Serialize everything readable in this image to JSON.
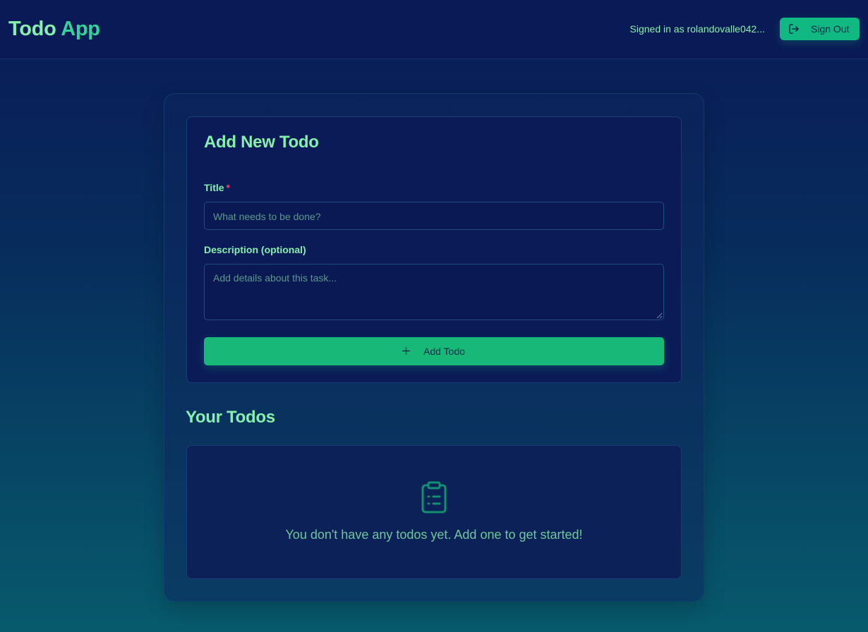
{
  "header": {
    "logo_word1": "Todo",
    "logo_word2": "App",
    "signed_in_text": "Signed in as rolandovalle042...",
    "sign_out_label": "Sign Out",
    "sign_out_icon": "log-out-icon"
  },
  "form": {
    "title": "Add New Todo",
    "title_label": "Title",
    "required_marker": "*",
    "title_placeholder": "What needs to be done?",
    "title_value": "",
    "description_label": "Description (optional)",
    "description_placeholder": "Add details about this task...",
    "description_value": "",
    "add_button_label": "Add Todo",
    "add_button_icon": "plus-icon"
  },
  "todos": {
    "heading": "Your Todos",
    "items": [],
    "empty_icon": "clipboard-list-icon",
    "empty_message": "You don't have any todos yet. Add one to get started!"
  },
  "colors": {
    "accent": "#10b981",
    "text_primary": "#86efac",
    "text_logo_secondary": "#34d399",
    "required": "#f43f5e",
    "background_top": "#0a1a57",
    "background_bottom": "#075a6c"
  }
}
